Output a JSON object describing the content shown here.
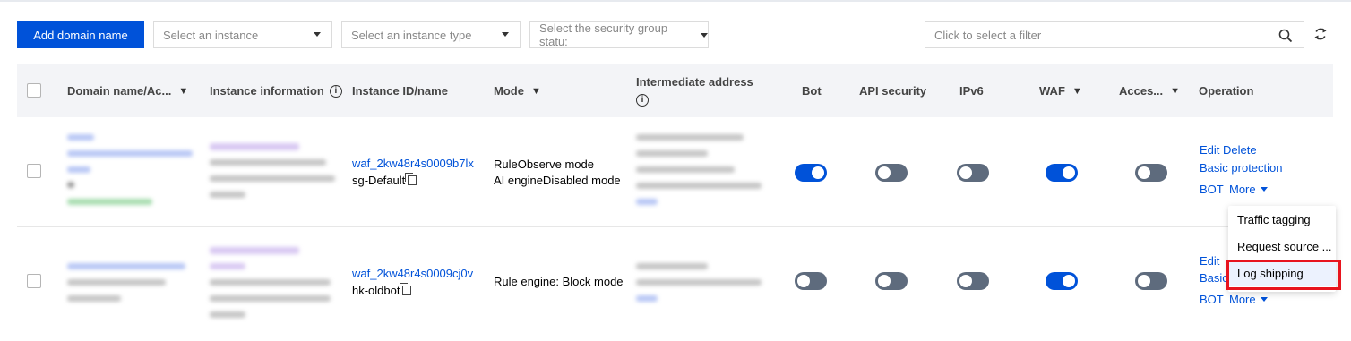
{
  "toolbar": {
    "add_button": "Add domain name",
    "instance_select": "Select an instance",
    "instance_type_select": "Select an instance type",
    "sg_status_select": "Select the security group statu:",
    "filter_placeholder": "Click to select a filter"
  },
  "table": {
    "columns": [
      "Domain name/Ac...",
      "Instance information",
      "Instance ID/name",
      "Mode",
      "Intermediate address",
      "Bot",
      "API security",
      "IPv6",
      "WAF",
      "Acces...",
      "Operation"
    ],
    "rows": [
      {
        "instance_id": "waf_2kw48r4s0009b7lx",
        "instance_name": "sg-Default",
        "mode_line1": "RuleObserve mode",
        "mode_line2": "AI engineDisabled mode",
        "bot": true,
        "api_security": false,
        "ipv6": false,
        "waf": true,
        "access": false,
        "ops": {
          "edit": "Edit",
          "delete": "Delete",
          "basic": "Basic protection",
          "bot": "BOT",
          "more": "More"
        }
      },
      {
        "instance_id": "waf_2kw48r4s0009cj0v",
        "instance_name": "hk-oldbot",
        "mode_line1": "Rule engine: Block mode",
        "bot": false,
        "api_security": false,
        "ipv6": false,
        "waf": true,
        "access": false,
        "ops": {
          "edit": "Edit",
          "basic": "Basic",
          "bot": "BOT",
          "more": "More"
        }
      }
    ]
  },
  "more_menu": {
    "items": [
      "Traffic tagging",
      "Request source ...",
      "Log shipping"
    ],
    "highlighted": "Log shipping"
  },
  "colors": {
    "primary": "#0052d9",
    "toggle_off": "#5e6b7d",
    "highlight_box": "#e8141e"
  }
}
